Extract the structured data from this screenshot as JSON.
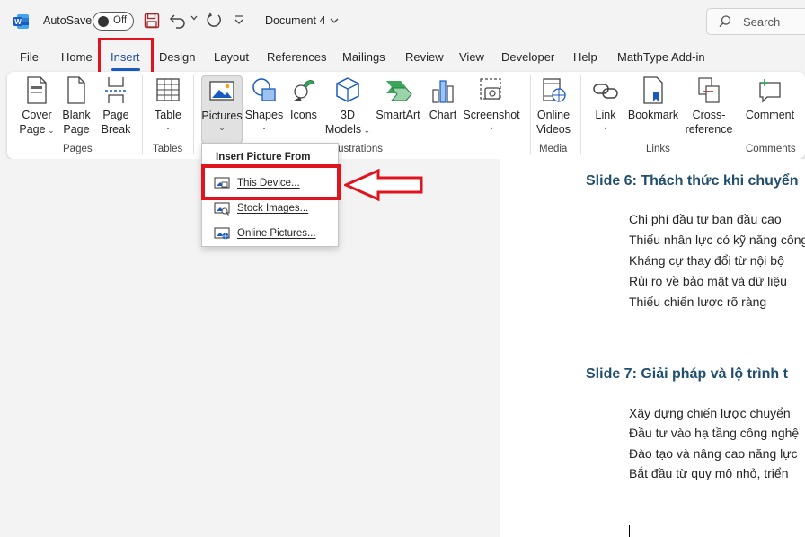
{
  "titlebar": {
    "autosave_label": "AutoSave",
    "autosave_state": "Off",
    "document_title": "Document 4",
    "search_placeholder": "Search"
  },
  "tabs": [
    {
      "label": "File"
    },
    {
      "label": "Home"
    },
    {
      "label": "Insert",
      "active": true
    },
    {
      "label": "Design"
    },
    {
      "label": "Layout"
    },
    {
      "label": "References"
    },
    {
      "label": "Mailings"
    },
    {
      "label": "Review"
    },
    {
      "label": "View"
    },
    {
      "label": "Developer"
    },
    {
      "label": "Help"
    },
    {
      "label": "MathType Add-in"
    }
  ],
  "ribbon": {
    "pages": {
      "cover_page": [
        "Cover",
        "Page"
      ],
      "blank_page": [
        "Blank",
        "Page"
      ],
      "page_break": [
        "Page",
        "Break"
      ],
      "group_label": "Pages"
    },
    "tables": {
      "table": "Table",
      "group_label": "Tables"
    },
    "illustrations": {
      "pictures": "Pictures",
      "shapes": "Shapes",
      "icons": "Icons",
      "models_3d": [
        "3D",
        "Models"
      ],
      "smartart": "SmartArt",
      "chart": "Chart",
      "screenshot": "Screenshot",
      "group_label": "llustrations"
    },
    "media": {
      "online_videos": [
        "Online",
        "Videos"
      ],
      "group_label": "Media"
    },
    "links": {
      "link": "Link",
      "bookmark": "Bookmark",
      "cross_reference": [
        "Cross-",
        "reference"
      ],
      "group_label": "Links"
    },
    "comments": {
      "comment": "Comment",
      "group_label": "Comments"
    }
  },
  "dropdown": {
    "header": "Insert Picture From",
    "items": [
      {
        "label": "This Device..."
      },
      {
        "label": "Stock Images..."
      },
      {
        "label": "Online Pictures..."
      }
    ]
  },
  "document": {
    "slide6_title": "Slide 6: Thách thức khi chuyển",
    "slide6_bullets": [
      "Chi phí đầu tư ban đầu cao",
      "Thiếu nhân lực có kỹ năng công",
      "Kháng cự thay đổi từ nội bộ",
      "Rủi ro về bảo mật và dữ liệu",
      "Thiếu chiến lược rõ ràng"
    ],
    "slide7_title": "Slide 7: Giải pháp và lộ trình t",
    "slide7_bullets": [
      "Xây dựng chiến lược chuyển",
      "Đầu tư vào hạ tầng công nghệ",
      "Đào tạo và nâng cao năng lực",
      "Bắt đầu từ quy mô nhỏ, triển"
    ]
  },
  "colors": {
    "accent_blue": "#185abd",
    "highlight_red": "#e0141e",
    "heading_color": "#1f4e6e"
  }
}
